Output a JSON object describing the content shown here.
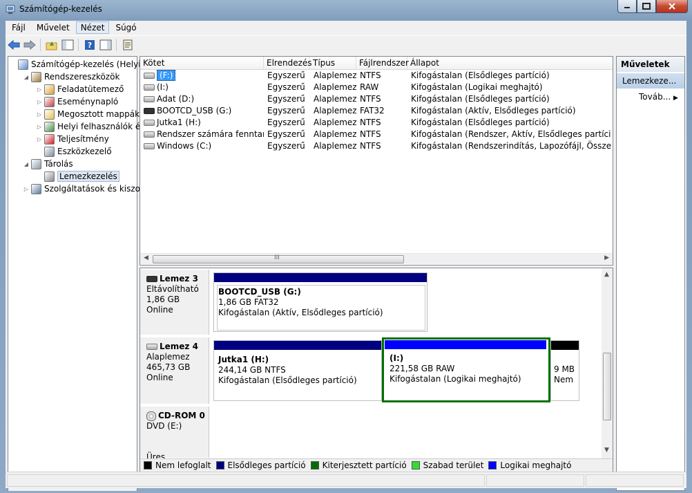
{
  "window": {
    "title": "Számítógép-kezelés"
  },
  "menu": [
    "Fájl",
    "Művelet",
    "Nézet",
    "Súgó"
  ],
  "menu_active_index": 2,
  "toolbar": {
    "icons": [
      "back-arrow-icon",
      "forward-arrow-icon",
      "up-folder-icon",
      "show-hide-tree-icon",
      "help-icon",
      "show-hide-action-pane-icon",
      "properties-icon"
    ]
  },
  "tree": {
    "items": [
      {
        "label": "Számítógép-kezelés (Helyi)",
        "level": 0,
        "expander": "",
        "icon": "computer-management-icon"
      },
      {
        "label": "Rendszereszközök",
        "level": 1,
        "expander": "◢",
        "icon": "tools-icon"
      },
      {
        "label": "Feladatütemező",
        "level": 2,
        "expander": "▷",
        "icon": "clock-icon"
      },
      {
        "label": "Eseménynapló",
        "level": 2,
        "expander": "▷",
        "icon": "event-viewer-icon"
      },
      {
        "label": "Megosztott mappák",
        "level": 2,
        "expander": "▷",
        "icon": "shared-folder-icon"
      },
      {
        "label": "Helyi felhasználók és cs",
        "level": 2,
        "expander": "▷",
        "icon": "users-icon"
      },
      {
        "label": "Teljesítmény",
        "level": 2,
        "expander": "▷",
        "icon": "performance-icon"
      },
      {
        "label": "Eszközkezelő",
        "level": 2,
        "expander": "",
        "icon": "device-manager-icon"
      },
      {
        "label": "Tárolás",
        "level": 1,
        "expander": "◢",
        "icon": "storage-icon"
      },
      {
        "label": "Lemezkezelés",
        "level": 2,
        "expander": "",
        "icon": "disk-management-icon",
        "selected": true
      },
      {
        "label": "Szolgáltatások és kiszolgáló",
        "level": 1,
        "expander": "▷",
        "icon": "services-icon"
      }
    ]
  },
  "volumes": {
    "columns": [
      "Kötet",
      "Elrendezés",
      "Típus",
      "Fájlrendszer",
      "Állapot"
    ],
    "rows": [
      {
        "name": "(F:)",
        "layout": "Egyszerű",
        "type": "Alaplemez",
        "fs": "NTFS",
        "status": "Kifogástalan (Elsődleges partíció)",
        "icon": "drive-icon",
        "selected": true
      },
      {
        "name": "(I:)",
        "layout": "Egyszerű",
        "type": "Alaplemez",
        "fs": "RAW",
        "status": "Kifogástalan (Logikai meghajtó)",
        "icon": "drive-icon"
      },
      {
        "name": "Adat (D:)",
        "layout": "Egyszerű",
        "type": "Alaplemez",
        "fs": "NTFS",
        "status": "Kifogástalan (Elsődleges partíció)",
        "icon": "drive-icon"
      },
      {
        "name": "BOOTCD_USB (G:)",
        "layout": "Egyszerű",
        "type": "Alaplemez",
        "fs": "FAT32",
        "status": "Kifogástalan (Aktív, Elsődleges partíció)",
        "icon": "usb-drive-icon"
      },
      {
        "name": "Jutka1 (H:)",
        "layout": "Egyszerű",
        "type": "Alaplemez",
        "fs": "NTFS",
        "status": "Kifogástalan (Elsődleges partíció)",
        "icon": "drive-icon"
      },
      {
        "name": "Rendszer számára fenntartott",
        "layout": "Egyszerű",
        "type": "Alaplemez",
        "fs": "NTFS",
        "status": "Kifogástalan (Rendszer, Aktív, Elsődleges partíció)",
        "icon": "drive-icon"
      },
      {
        "name": "Windows (C:)",
        "layout": "Egyszerű",
        "type": "Alaplemez",
        "fs": "NTFS",
        "status": "Kifogástalan (Rendszerindítás, Lapozófájl, Összeomlási r",
        "icon": "drive-icon"
      }
    ],
    "scroll_grip": "III"
  },
  "disks": [
    {
      "name": "Lemez 3",
      "kind": "Eltávolítható",
      "size": "1,86 GB",
      "state": "Online",
      "partitions": [
        {
          "title": "BOOTCD_USB  (G:)",
          "line1": "1,86 GB FAT32",
          "line2": "Kifogástalan (Aktív, Elsődleges partíció)",
          "bar_color": "#000080"
        }
      ]
    },
    {
      "name": "Lemez 4",
      "kind": "Alaplemez",
      "size": "465,73 GB",
      "state": "Online",
      "partitions": [
        {
          "title": "Jutka1  (H:)",
          "line1": "244,14 GB NTFS",
          "line2": "Kifogástalan (Elsődleges partíció)",
          "bar_color": "#000080"
        },
        {
          "title": "(I:)",
          "line1": "221,58 GB RAW",
          "line2": "Kifogástalan (Logikai meghajtó)",
          "bar_color": "#0000ff",
          "extended_border": "#007000"
        },
        {
          "title": "",
          "line1": "9 MB",
          "line2": "Nem",
          "bar_color": "#000000"
        }
      ]
    },
    {
      "name": "CD-ROM 0",
      "kind": "DVD (E:)",
      "size": "",
      "state": "Üres",
      "partitions": []
    }
  ],
  "legend": [
    {
      "label": "Nem lefoglalt",
      "color": "#000000"
    },
    {
      "label": "Elsődleges partíció",
      "color": "#000080"
    },
    {
      "label": "Kiterjesztett partíció",
      "color": "#007000"
    },
    {
      "label": "Szabad terület",
      "color": "#33dd33"
    },
    {
      "label": "Logikai meghajtó",
      "color": "#0000ff"
    }
  ],
  "actions": {
    "header": "Műveletek",
    "subheader": "Lemezkeze...",
    "more": "Továb..."
  }
}
